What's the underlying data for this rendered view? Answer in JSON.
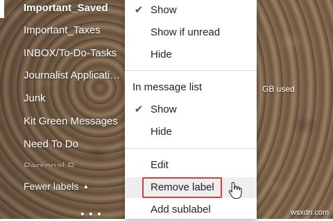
{
  "labels": [
    {
      "name": "Important_Saved",
      "active": true
    },
    {
      "name": "Important_Taxes"
    },
    {
      "name": "INBOX/To-Do-Tasks"
    },
    {
      "name": "Journalist Applicati…"
    },
    {
      "name": "Junk"
    },
    {
      "name": "Kit Green Messages"
    },
    {
      "name": "Need To Do"
    },
    {
      "name": "Personal R…"
    }
  ],
  "fewer_labels": "Fewer labels",
  "more_dots": "• • •",
  "storage_text": "GB used",
  "watermark": "wsxdn.com",
  "menu": {
    "label_list_section": {
      "show": "Show",
      "show_if_unread": "Show if unread",
      "hide": "Hide",
      "checked": "Show"
    },
    "message_list_header": "In message list",
    "message_list_section": {
      "show": "Show",
      "hide": "Hide",
      "checked": "Show"
    },
    "edit": "Edit",
    "remove_label": "Remove label",
    "add_sublabel": "Add sublabel",
    "check_glyph": "✔"
  },
  "colors": {
    "highlight_box": "#e03a3a",
    "menu_bg": "#ffffff",
    "hover_bg": "#eeeeee"
  }
}
